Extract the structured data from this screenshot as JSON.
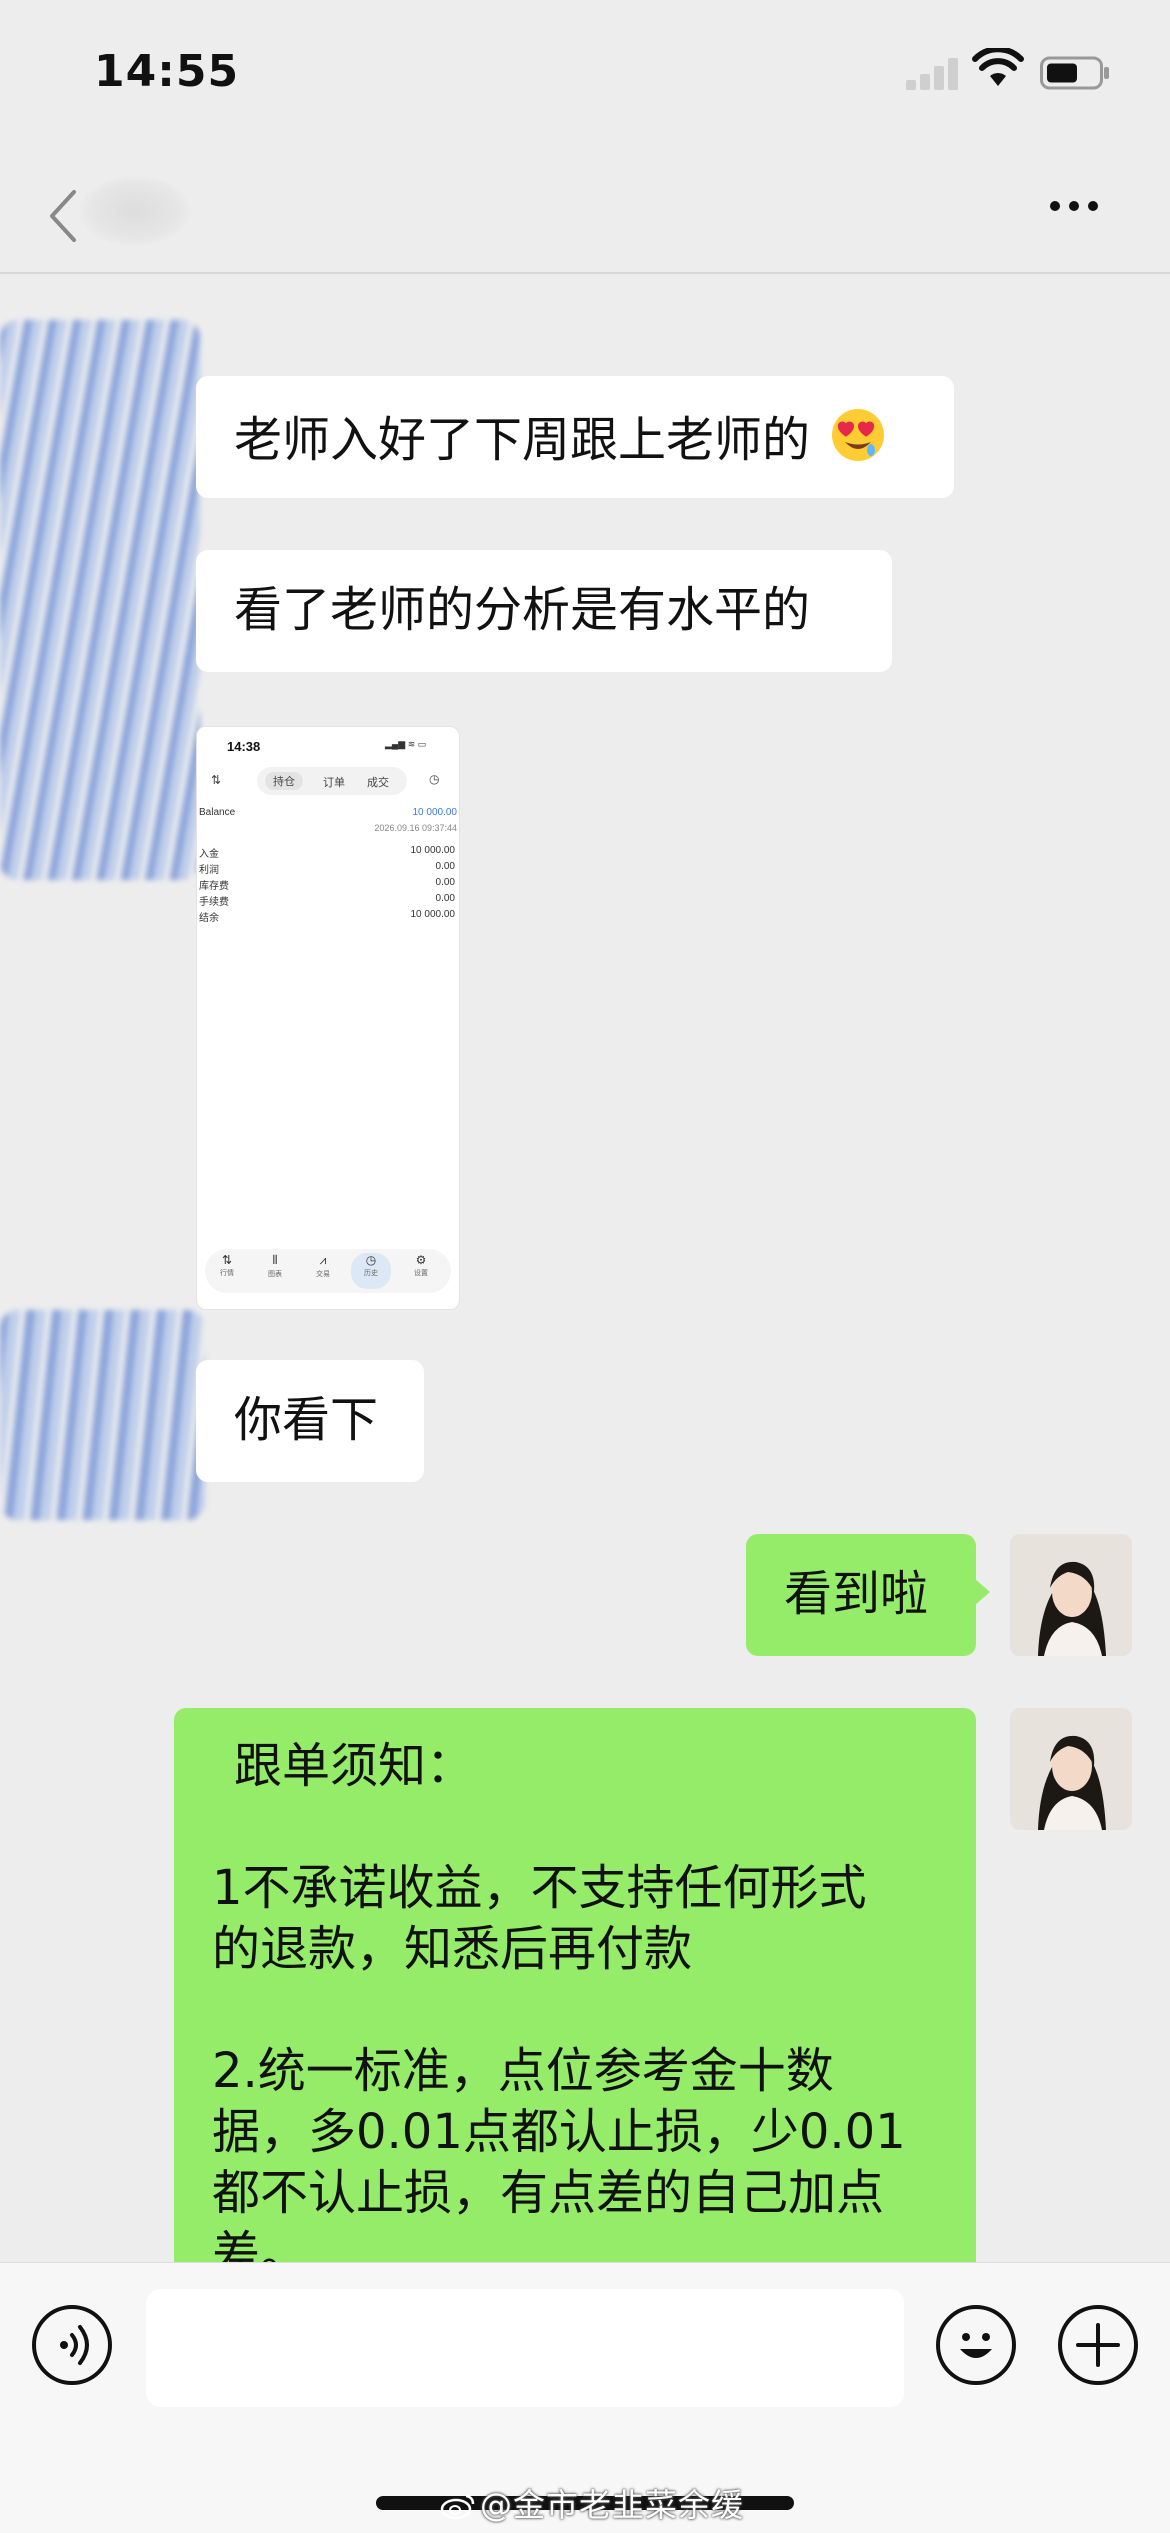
{
  "status_bar": {
    "time": "14:55"
  },
  "nav": {
    "title": ""
  },
  "messages": [
    {
      "side": "left",
      "text": "老师入好了下周跟上老师的"
    },
    {
      "side": "left",
      "text": "看了老师的分析是有水平的"
    },
    {
      "side": "left",
      "text": "你看下"
    },
    {
      "side": "right",
      "text": "看到啦"
    }
  ],
  "notice": {
    "title": "跟单须知：",
    "p1_line1": "1不承诺收益，不支持任何形式",
    "p1_line2": "的退款，知悉后再付款",
    "p2_line1": "2.统一标准，点位参考金十数",
    "p2_line2": "据，多0.01点都认止损，少0.01",
    "p2_line3": "都不认止损，有点差的自己加点",
    "p2_line4": "差。"
  },
  "screenshot": {
    "time": "14:38",
    "tabs": [
      "持仓",
      "订单",
      "成交"
    ],
    "balance_label": "Balance",
    "balance_value": "10 000.00",
    "timestamp": "2026.09.16 09:37:44",
    "rows": [
      {
        "label": "入金",
        "value": "10 000.00"
      },
      {
        "label": "利润",
        "value": "0.00"
      },
      {
        "label": "库存费",
        "value": "0.00"
      },
      {
        "label": "手续费",
        "value": "0.00"
      },
      {
        "label": "结余",
        "value": "10 000.00"
      }
    ],
    "bottom_tabs": [
      "行情",
      "图表",
      "交易",
      "历史",
      "设置"
    ]
  },
  "watermark": "@金市老韭菜余缓",
  "colors": {
    "background": "#ededed",
    "self_bubble": "#95ec69",
    "other_bubble": "#ffffff"
  },
  "icons": [
    "back-icon",
    "more-icon",
    "voice-icon",
    "emoji-icon",
    "plus-icon",
    "wifi-icon",
    "battery-icon",
    "weibo-logo-icon"
  ]
}
